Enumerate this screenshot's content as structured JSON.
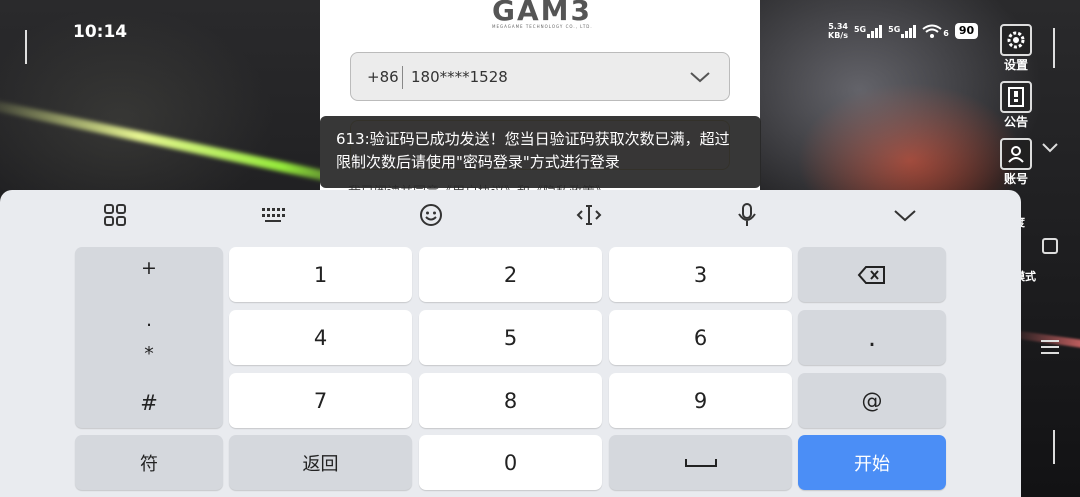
{
  "status": {
    "time": "10:14",
    "net_speed_value": "5.34",
    "net_speed_unit": "KB/s",
    "net1": "5G",
    "net2": "5G",
    "wifi_sub": "6",
    "battery": "90"
  },
  "side_menu": {
    "settings": "设置",
    "notice": "公告",
    "account": "账号",
    "partial_1": "度",
    "partial_2": "模式"
  },
  "login": {
    "logo": "GAM3",
    "logo_sub": "MEGAGAME TECHNOLOGY CO., LTD.",
    "country_code": "+86",
    "phone": "180****1528",
    "agree_text": "我已阅读并同意《用户协议》和《隐私政策》"
  },
  "toast": {
    "line1": "613:验证码已成功发送！您当日验证码获取次数已满，超过",
    "line2": "限制次数后请使用\"密码登录\"方式进行登录"
  },
  "keyboard": {
    "sym_col": [
      "+",
      ".",
      "*",
      "#"
    ],
    "digits": [
      "1",
      "2",
      "3",
      "4",
      "5",
      "6",
      "7",
      "8",
      "9",
      "0"
    ],
    "dot": ".",
    "at": "@",
    "symbols_label": "符",
    "back_label": "返回",
    "start_label": "开始"
  }
}
